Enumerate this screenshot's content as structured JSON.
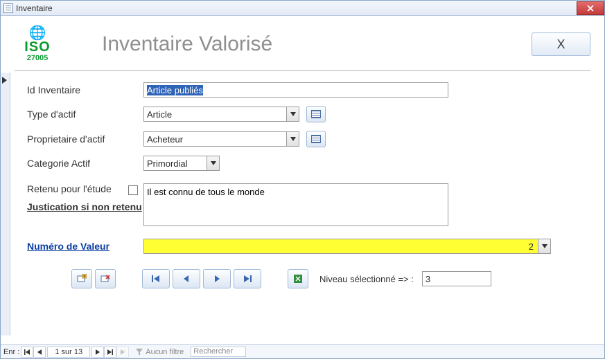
{
  "window": {
    "title": "Inventaire"
  },
  "header": {
    "logo": {
      "iso": "ISO",
      "code": "27005"
    },
    "title": "Inventaire Valorisé",
    "close_symbol": "X"
  },
  "form": {
    "id_inventaire": {
      "label": "Id Inventaire",
      "value": "Article publiés"
    },
    "type_actif": {
      "label": "Type d'actif",
      "value": "Article"
    },
    "proprietaire": {
      "label": "Proprietaire d'actif",
      "value": "Acheteur"
    },
    "categorie": {
      "label": "Categorie Actif",
      "value": "Primordial"
    },
    "retenu": {
      "label": "Retenu pour l'étude",
      "checked": false
    },
    "justification": {
      "label": "Justication si non retenu",
      "value": "Il est connu de tous le monde"
    },
    "numero_valeur": {
      "label": "Numéro de Valeur",
      "value": "2"
    },
    "niveau": {
      "label": "Niveau sélectionné => :",
      "value": "3"
    }
  },
  "statusbar": {
    "enr_label": "Enr :",
    "position": "1 sur 13",
    "filter": "Aucun filtre",
    "search_placeholder": "Rechercher"
  }
}
